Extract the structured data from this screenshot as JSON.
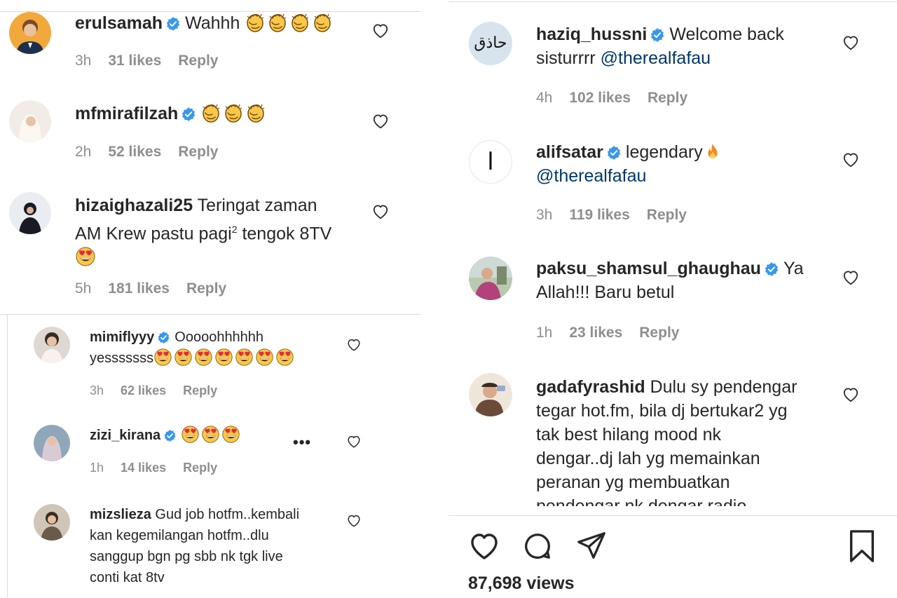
{
  "left": {
    "comments": [
      {
        "username": "erulsamah",
        "text": "Wahhh",
        "time": "3h",
        "likes": "31 likes",
        "reply": "Reply"
      },
      {
        "username": "mfmirafilzah",
        "text": "",
        "time": "2h",
        "likes": "52 likes",
        "reply": "Reply"
      },
      {
        "username": "hizaighazali25",
        "text_a": "Teringat zaman",
        "text_b": "AM Krew pastu pagi",
        "sup": "2",
        "text_c": " tengok 8TV",
        "time": "5h",
        "likes": "181 likes",
        "reply": "Reply"
      }
    ],
    "replies": [
      {
        "username": "mimiflyyy",
        "text_a": "Ooooohhhhhh",
        "text_b": "yesssssss",
        "time": "3h",
        "likes": "62 likes",
        "reply": "Reply"
      },
      {
        "username": "zizi_kirana",
        "more": "•••",
        "time": "1h",
        "likes": "14 likes",
        "reply": "Reply"
      },
      {
        "username": "mizslieza",
        "lines": [
          "Gud job hotfm..kembali",
          "kan kegemilangan hotfm..dlu",
          "sanggup bgn pg sbb nk tgk live",
          "conti kat 8tv"
        ]
      }
    ]
  },
  "right": {
    "comments": [
      {
        "username": "haziq_hussni",
        "avatar_text": "حاذق",
        "text_a": "Welcome back",
        "text_b": "sisturrrr ",
        "mention": "@therealfafau",
        "time": "4h",
        "likes": "102 likes",
        "reply": "Reply"
      },
      {
        "username": "alifsatar",
        "avatar_text": "ا",
        "text_a": "legendary",
        "mention": "@therealfafau",
        "time": "3h",
        "likes": "119 likes",
        "reply": "Reply"
      },
      {
        "username": "paksu_shamsul_ghaughau",
        "text_a": "Ya",
        "text_b": "Allah!!! Baru betul",
        "time": "1h",
        "likes": "23 likes",
        "reply": "Reply"
      },
      {
        "username": "gadafyrashid",
        "lines": [
          "Dulu sy pendengar",
          "tegar hot.fm, bila dj bertukar2 yg",
          "tak best hilang mood nk",
          "dengar..dj lah yg memainkan",
          "peranan yg membuatkan",
          "pendengar nk dengar radio"
        ]
      }
    ],
    "views": "87,698 views"
  },
  "colors": {
    "text": "#262626",
    "muted": "#8e8e8e",
    "verified": "#3897f0",
    "mention": "#00376b",
    "divider": "#dbdbdb"
  }
}
